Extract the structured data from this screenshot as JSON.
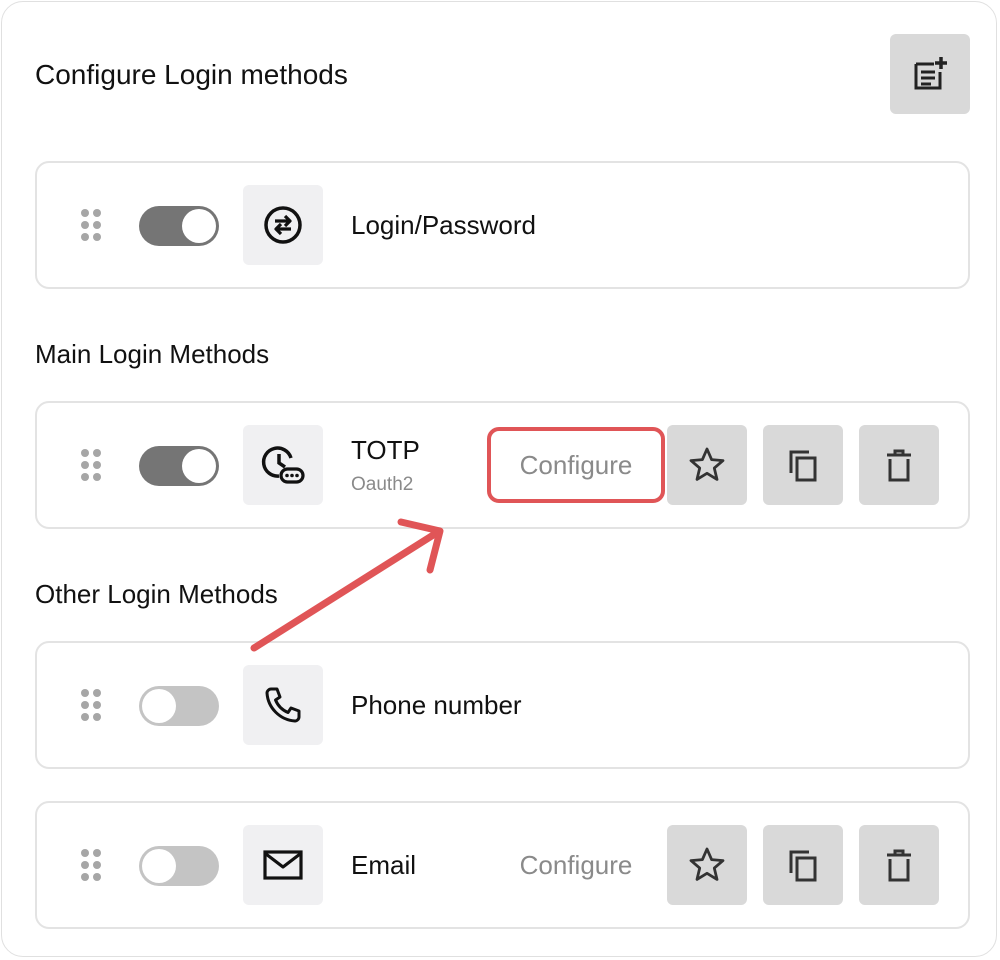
{
  "header": {
    "title": "Configure Login methods",
    "add_icon": "add-note-icon"
  },
  "primary_method": {
    "name": "Login/Password",
    "enabled": true,
    "icon": "swap-arrows-icon"
  },
  "main_section": {
    "label": "Main Login Methods",
    "methods": [
      {
        "name": "TOTP",
        "subtitle": "Oauth2",
        "enabled": true,
        "icon": "clock-password-icon",
        "configure_label": "Configure",
        "configure_highlighted": true
      }
    ]
  },
  "other_section": {
    "label": "Other Login Methods",
    "methods": [
      {
        "name": "Phone number",
        "enabled": false,
        "icon": "phone-icon"
      },
      {
        "name": "Email",
        "enabled": false,
        "icon": "mail-icon",
        "configure_label": "Configure"
      }
    ]
  },
  "annotation": {
    "arrow_color": "#e05557"
  },
  "colors": {
    "toggle_on": "#757575",
    "toggle_off": "#c4c4c4",
    "button_bg": "#d9d9d9",
    "icon_tile_bg": "#f0f0f2"
  }
}
